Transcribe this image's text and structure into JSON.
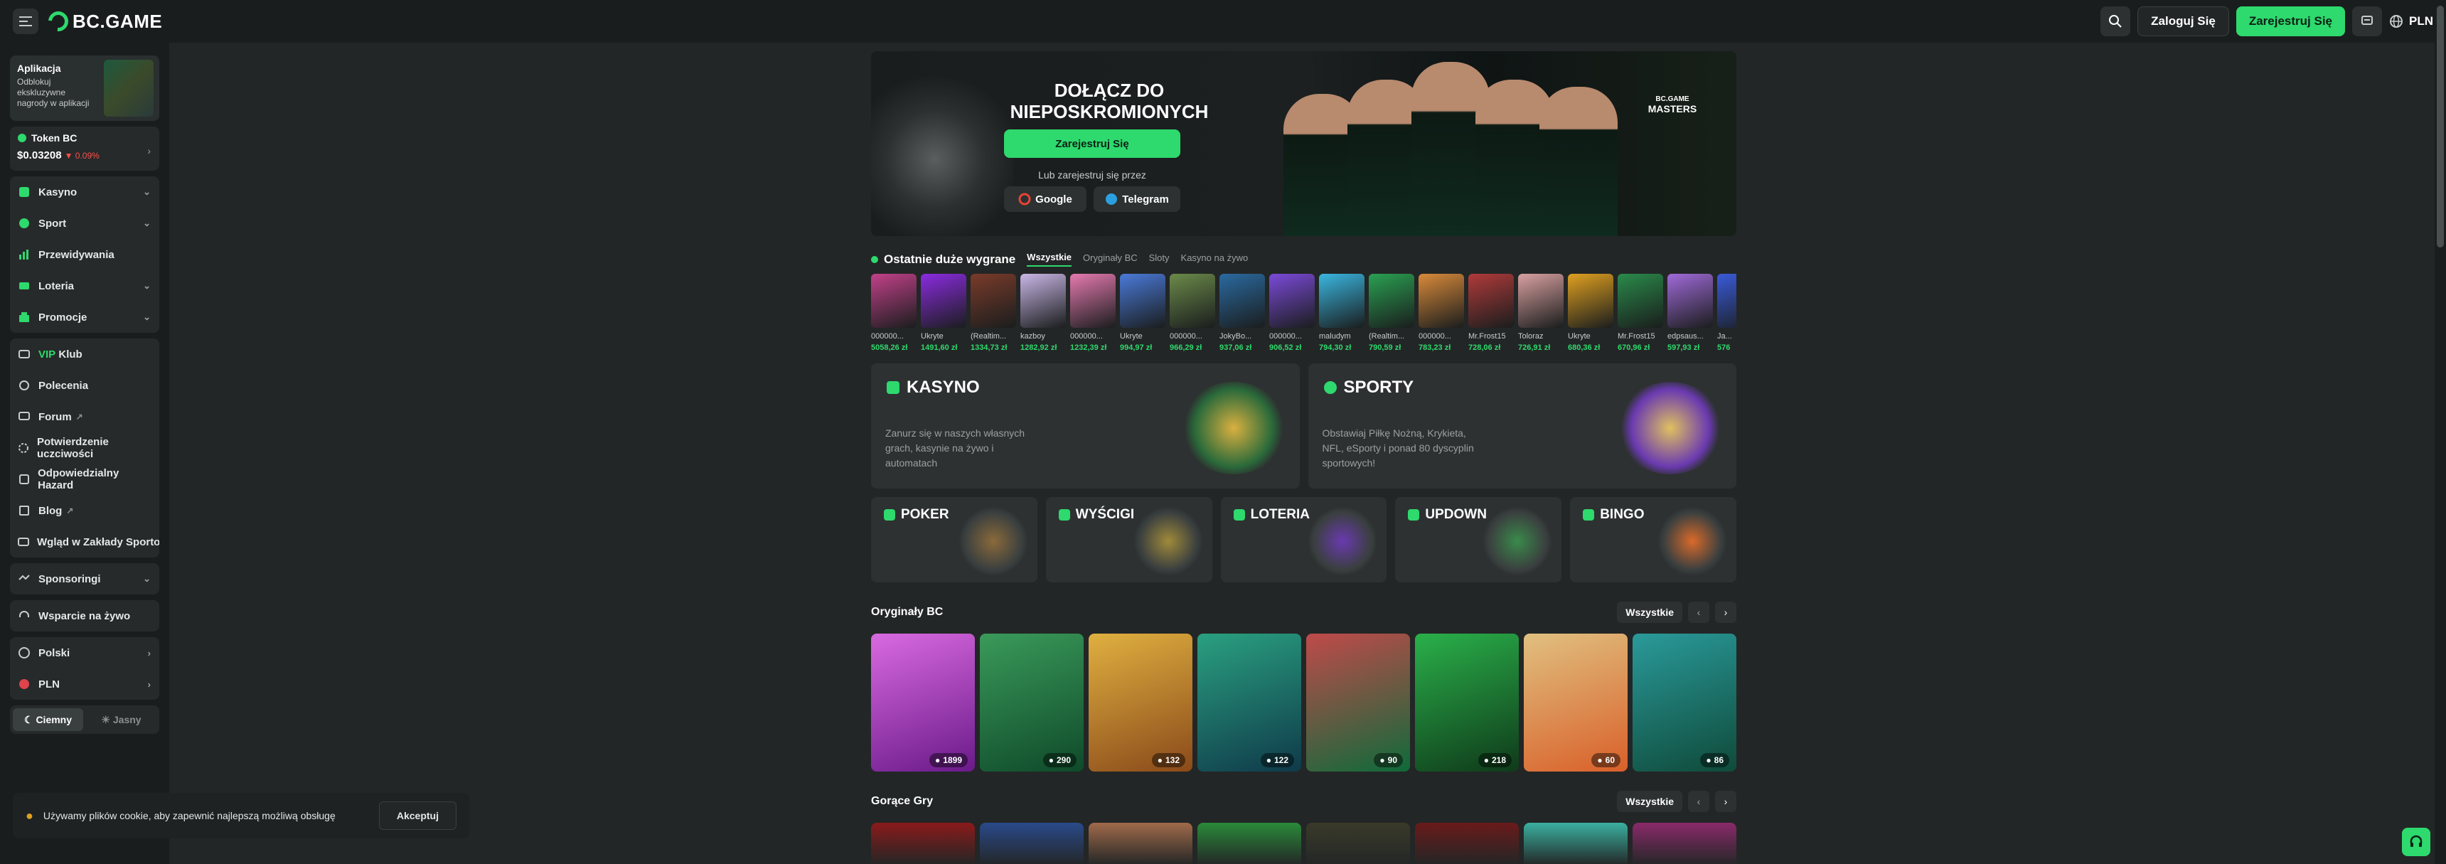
{
  "header": {
    "logo_text": "BC.GAME",
    "login_label": "Zaloguj Się",
    "register_label": "Zarejestruj Się",
    "currency": "PLN"
  },
  "sidebar": {
    "app_title": "Aplikacja",
    "app_desc": "Odblokuj ekskluzywne nagrody w aplikacji",
    "token_name": "Token BC",
    "token_price": "$0.03208",
    "token_change": "0.09%",
    "group1": [
      {
        "label": "Kasyno",
        "icon": "casino-icon",
        "expand": true
      },
      {
        "label": "Sport",
        "icon": "sport-icon",
        "expand": true
      },
      {
        "label": "Przewidywania",
        "icon": "prediction-icon",
        "expand": false
      },
      {
        "label": "Loteria",
        "icon": "lottery-icon",
        "expand": true
      },
      {
        "label": "Promocje",
        "icon": "promo-icon",
        "expand": true
      }
    ],
    "vip_label": "VIP",
    "vip_suffix": " Klub",
    "group2": [
      {
        "label": "Polecenia",
        "icon": "referral-icon"
      },
      {
        "label": "Forum",
        "icon": "forum-icon",
        "external": true
      },
      {
        "label": "Potwierdzenie uczciwości",
        "icon": "fairness-icon"
      },
      {
        "label": "Odpowiedzialny Hazard",
        "icon": "responsible-icon"
      },
      {
        "label": "Blog",
        "icon": "blog-icon",
        "external": true
      },
      {
        "label": "Wgląd w Zakłady Sportowe",
        "icon": "insight-icon"
      }
    ],
    "sponsor_label": "Sponsoringi",
    "support_label": "Wsparcie na żywo",
    "language_label": "Polski",
    "currency_label": "PLN",
    "theme_dark": "Ciemny",
    "theme_light": "Jasny"
  },
  "cookie": {
    "text": "Używamy plików cookie, aby zapewnić najlepszą możliwą obsługę",
    "accept_label": "Akceptuj"
  },
  "hero": {
    "title_line1": "DOŁĄCZ DO",
    "title_line2": "NIEPOSKROMIONYCH",
    "cta_label": "Zarejestruj Się",
    "or_text": "Lub zarejestruj się przez",
    "google_label": "Google",
    "telegram_label": "Telegram",
    "masters_line1": "BC.GAME",
    "masters_line2": "MASTERS"
  },
  "wins": {
    "title": "Ostatnie duże wygrane",
    "tabs": [
      "Wszystkie",
      "Oryginały BC",
      "Sloty",
      "Kasyno na żywo"
    ],
    "items": [
      {
        "user": "000000...",
        "amount": "5058,26 zł",
        "color": "#c2418a"
      },
      {
        "user": "Ukryte",
        "amount": "1491,60 zł",
        "color": "#8b2be0"
      },
      {
        "user": "(Realtim...",
        "amount": "1334,73 zł",
        "color": "#7a3b2a"
      },
      {
        "user": "kazboy",
        "amount": "1282,92 zł",
        "color": "#c9b6e6"
      },
      {
        "user": "000000...",
        "amount": "1232,39 zł",
        "color": "#e67ab0"
      },
      {
        "user": "Ukryte",
        "amount": "994,97 zł",
        "color": "#4a7ad9"
      },
      {
        "user": "000000...",
        "amount": "966,29 zł",
        "color": "#6b8a4a"
      },
      {
        "user": "JokyBo...",
        "amount": "937,06 zł",
        "color": "#2a6aa0"
      },
      {
        "user": "000000...",
        "amount": "906,52 zł",
        "color": "#7b4ad9"
      },
      {
        "user": "maludym",
        "amount": "794,30 zł",
        "color": "#3ab6e0"
      },
      {
        "user": "(Realtim...",
        "amount": "790,59 zł",
        "color": "#2aa052"
      },
      {
        "user": "000000...",
        "amount": "783,23 zł",
        "color": "#d98a3a"
      },
      {
        "user": "Mr.Frost15",
        "amount": "728,06 zł",
        "color": "#b03a3a"
      },
      {
        "user": "Toloraz",
        "amount": "726,91 zł",
        "color": "#d9a0a0"
      },
      {
        "user": "Ukryte",
        "amount": "680,36 zł",
        "color": "#e0a020"
      },
      {
        "user": "Mr.Frost15",
        "amount": "670,96 zł",
        "color": "#2a8a4a"
      },
      {
        "user": "edpsaus...",
        "amount": "597,93 zł",
        "color": "#a06ad9"
      },
      {
        "user": "Ja...",
        "amount": "576",
        "color": "#3a5ad9"
      }
    ]
  },
  "categories": {
    "casino_title": "KASYNO",
    "casino_desc": "Zanurz się w naszych własnych grach, kasynie na żywo i automatach",
    "sports_title": "SPORTY",
    "sports_desc": "Obstawiaj Piłkę Nożną, Krykieta, NFL, eSporty i ponad 80 dyscyplin sportowych!",
    "small": [
      {
        "title": "POKER",
        "color": "#8a6a3a"
      },
      {
        "title": "WYŚCIGI",
        "color": "#a08a3a"
      },
      {
        "title": "LOTERIA",
        "color": "#6a3ab0"
      },
      {
        "title": "UPDOWN",
        "color": "#3a8a4a"
      },
      {
        "title": "BINGO",
        "color": "#d96a2a"
      }
    ]
  },
  "originals": {
    "title": "Oryginały BC",
    "all_label": "Wszystkie",
    "games": [
      {
        "players": "1899",
        "bg": "linear-gradient(160deg,#d96ae0,#6a1a8a)"
      },
      {
        "players": "290",
        "bg": "linear-gradient(160deg,#3a9a5a,#0f4a2a)"
      },
      {
        "players": "132",
        "bg": "linear-gradient(160deg,#e0b040,#8a4a1a)"
      },
      {
        "players": "122",
        "bg": "linear-gradient(160deg,#2aa080,#0f3a4a)"
      },
      {
        "players": "90",
        "bg": "linear-gradient(160deg,#c04a4a,#0f6a3a)"
      },
      {
        "players": "218",
        "bg": "linear-gradient(160deg,#2ab04a,#0f3a1a)"
      },
      {
        "players": "60",
        "bg": "linear-gradient(160deg,#e0c080,#d9602a)"
      },
      {
        "players": "86",
        "bg": "linear-gradient(160deg,#2a9a9a,#0f4a3a)"
      }
    ]
  },
  "hot": {
    "title": "Gorące Gry",
    "all_label": "Wszystkie",
    "colors": [
      "#8a1a1a",
      "#2a4a8a",
      "#a06a4a",
      "#2a8a3a",
      "#3a3a2a",
      "#6a1a1a",
      "#3ab0a0",
      "#8a2a6a"
    ]
  }
}
